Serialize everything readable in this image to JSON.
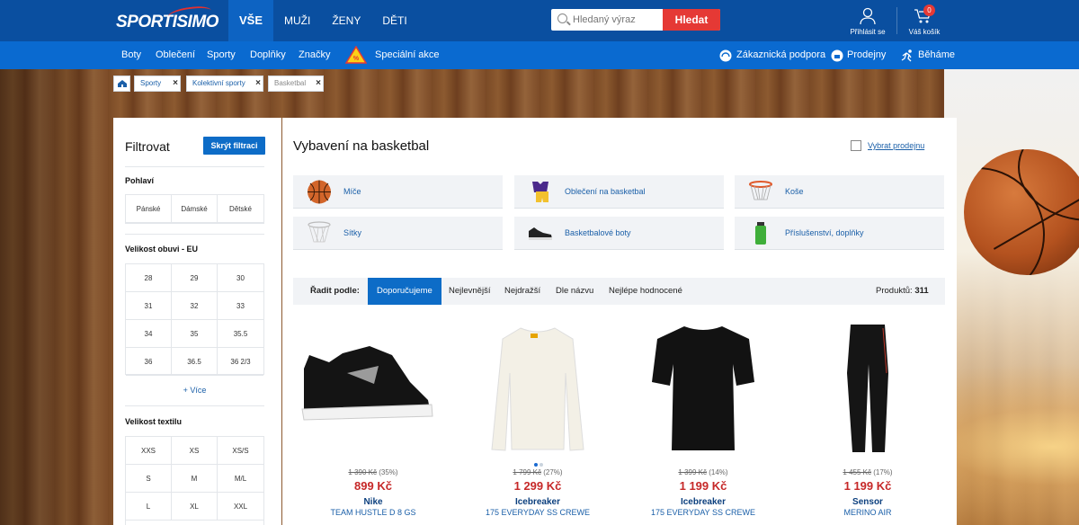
{
  "header": {
    "logo_text": "SPORTISIMO",
    "nav": [
      "VŠE",
      "MUŽI",
      "ŽENY",
      "DĚTI"
    ],
    "search_placeholder": "Hledaný výraz",
    "search_button": "Hledat",
    "login_label": "Přihlásit se",
    "cart_label": "Váš košík",
    "cart_count": "0"
  },
  "subnav": {
    "items": [
      "Boty",
      "Oblečení",
      "Sporty",
      "Doplňky",
      "Značky"
    ],
    "special": "Speciální akce",
    "support": "Zákaznická podpora",
    "stores": "Prodejny",
    "running": "Běháme"
  },
  "breadcrumb": [
    "Sporty",
    "Kolektivní sporty",
    "Basketbal"
  ],
  "filter": {
    "title": "Filtrovat",
    "hide_button": "Skrýt filtraci",
    "gender_heading": "Pohlaví",
    "genders": [
      "Pánské",
      "Dámské",
      "Dětské"
    ],
    "shoe_heading": "Velikost obuvi - EU",
    "shoe_sizes": [
      "28",
      "29",
      "30",
      "31",
      "32",
      "33",
      "34",
      "35",
      "35.5",
      "36",
      "36.5",
      "36 2/3"
    ],
    "more": "+ Více",
    "textile_heading": "Velikost textilu",
    "textile_sizes": [
      "XXS",
      "XS",
      "XS/S",
      "S",
      "M",
      "M/L",
      "L",
      "XL",
      "XXL"
    ]
  },
  "main": {
    "title": "Vybavení na basketbal",
    "store_link": "Vybrat prodejnu",
    "categories": [
      "Míče",
      "Oblečení na basketbal",
      "Koše",
      "Sítky",
      "Basketbalové boty",
      "Příslušenství, doplňky"
    ],
    "sort_label": "Řadit podle:",
    "sort_options": [
      "Doporučujeme",
      "Nejlevnější",
      "Nejdražší",
      "Dle názvu",
      "Nejlépe hodnocené"
    ],
    "products_label": "Produktů:",
    "products_count": "311"
  },
  "products": [
    {
      "old_price": "1 390 Kč",
      "discount": "(35%)",
      "price": "899 Kč",
      "brand": "Nike",
      "name": "TEAM HUSTLE D 8 GS"
    },
    {
      "old_price": "1 799 Kč",
      "discount": "(27%)",
      "price": "1 299 Kč",
      "brand": "Icebreaker",
      "name": "175 EVERYDAY SS CREWE"
    },
    {
      "old_price": "1 399 Kč",
      "discount": "(14%)",
      "price": "1 199 Kč",
      "brand": "Icebreaker",
      "name": "175 EVERYDAY SS CREWE"
    },
    {
      "old_price": "1 455 Kč",
      "discount": "(17%)",
      "price": "1 199 Kč",
      "brand": "Sensor",
      "name": "MERINO AIR"
    }
  ],
  "colors": {
    "primary": "#0a4fa0",
    "accent": "#0a6ad0",
    "price": "#c62828",
    "search_button": "#e53935"
  },
  "icons": [
    "search-icon",
    "user-icon",
    "cart-icon",
    "warning-icon",
    "support-icon",
    "store-icon",
    "runner-icon",
    "home-icon"
  ]
}
